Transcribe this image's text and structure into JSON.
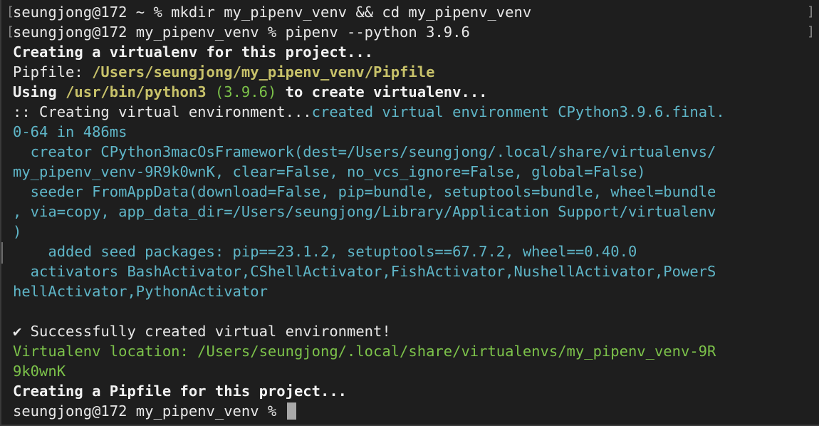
{
  "terminal": {
    "lines": {
      "l1": "seungjong@172 ~ % mkdir my_pipenv_venv && cd my_pipenv_venv",
      "l2": "seungjong@172 my_pipenv_venv % pipenv --python 3.9.6",
      "l3": "Creating a virtualenv for this project...",
      "l4a": "Pipfile: ",
      "l4b": "/Users/seungjong/my_pipenv_venv/Pipfile",
      "l5a": "Using ",
      "l5b": "/usr/bin/python3",
      "l5c": " (3.9.6) ",
      "l5d": "to create virtualenv...",
      "l6a": ":: Creating virtual environment...",
      "l6b": "created virtual environment CPython3.9.6.final.",
      "l7": "0-64 in 486ms",
      "l8": "  creator CPython3macOsFramework(dest=/Users/seungjong/.local/share/virtualenvs/",
      "l9": "my_pipenv_venv-9R9k0wnK, clear=False, no_vcs_ignore=False, global=False)",
      "l10": "  seeder FromAppData(download=False, pip=bundle, setuptools=bundle, wheel=bundle",
      "l11": ", via=copy, app_data_dir=/Users/seungjong/Library/Application Support/virtualenv",
      "l12": ")",
      "l13": "    added seed packages: pip==23.1.2, setuptools==67.7.2, wheel==0.40.0",
      "l14": "  activators BashActivator,CShellActivator,FishActivator,NushellActivator,PowerS",
      "l15": "hellActivator,PythonActivator",
      "l16": "",
      "l17": "✔ Successfully created virtual environment!",
      "l18": "Virtualenv location: /Users/seungjong/.local/share/virtualenvs/my_pipenv_venv-9R",
      "l19": "9k0wnK",
      "l20": "Creating a Pipfile for this project...",
      "l21": "seungjong@172 my_pipenv_venv % "
    },
    "bracket_open": "[",
    "bracket_close": "]"
  },
  "colors": {
    "background": "#1e1e1e",
    "text": "#e8e8e8",
    "path_yellow": "#c8c26a",
    "info_cyan": "#5fb6c8",
    "success_green": "#7cc24a",
    "cursor": "#a8a8a8"
  }
}
